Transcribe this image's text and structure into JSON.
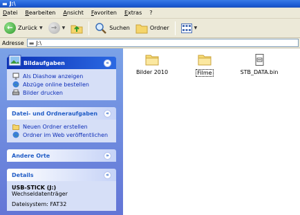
{
  "window": {
    "title": "J:\\"
  },
  "menu": [
    "Datei",
    "Bearbeiten",
    "Ansicht",
    "Favoriten",
    "Extras",
    "?"
  ],
  "toolbar": {
    "back_label": "Zurück",
    "search_label": "Suchen",
    "folders_label": "Ordner"
  },
  "address": {
    "label": "Adresse",
    "value": "J:\\"
  },
  "picture_tasks": {
    "title": "Bildaufgaben",
    "items": [
      "Als Diashow anzeigen",
      "Abzüge online bestellen",
      "Bilder drucken"
    ]
  },
  "file_tasks": {
    "title": "Datei- und Ordneraufgaben",
    "items": [
      "Neuen Ordner erstellen",
      "Ordner im Web veröffentlichen"
    ]
  },
  "other_places": {
    "title": "Andere Orte"
  },
  "details": {
    "title": "Details",
    "name": "USB-STICK (J:)",
    "type": "Wechseldatenträger",
    "filesystem": "Dateisystem: FAT32"
  },
  "files": [
    {
      "name": "Bilder 2010",
      "kind": "folder"
    },
    {
      "name": "Filme",
      "kind": "folder",
      "focused": true
    },
    {
      "name": "STB_DATA.bin",
      "kind": "file"
    }
  ]
}
